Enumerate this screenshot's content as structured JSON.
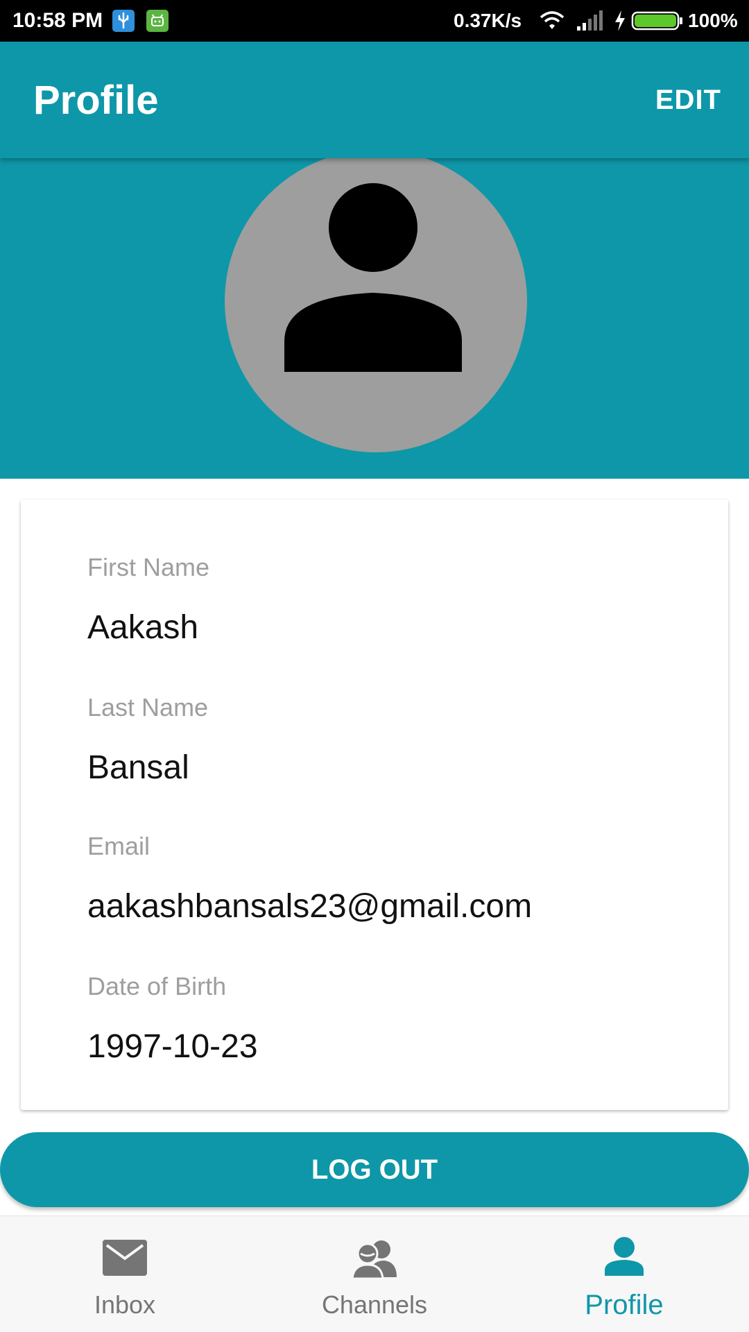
{
  "status_bar": {
    "time": "10:58 PM",
    "network_speed": "0.37K/s",
    "battery_percent": "100%",
    "battery_level": 1.0,
    "icons": [
      "usb-icon",
      "android-icon",
      "wifi-icon",
      "signal-icon",
      "charging-icon",
      "battery-icon"
    ]
  },
  "app_bar": {
    "title": "Profile",
    "edit_label": "EDIT"
  },
  "profile": {
    "avatar_icon": "person-icon",
    "fields": [
      {
        "label": "First Name",
        "value": "Aakash"
      },
      {
        "label": "Last Name",
        "value": "Bansal"
      },
      {
        "label": "Email",
        "value": "aakashbansals23@gmail.com"
      },
      {
        "label": "Date of Birth",
        "value": "1997-10-23"
      }
    ]
  },
  "logout_label": "LOG OUT",
  "bottom_nav": {
    "items": [
      {
        "label": "Inbox",
        "icon": "mail-icon",
        "active": false
      },
      {
        "label": "Channels",
        "icon": "group-icon",
        "active": false
      },
      {
        "label": "Profile",
        "icon": "person-icon",
        "active": true
      }
    ]
  },
  "colors": {
    "primary": "#0e97a8",
    "avatar_bg": "#9e9e9e",
    "label_gray": "#9e9e9e",
    "nav_inactive": "#757575"
  }
}
